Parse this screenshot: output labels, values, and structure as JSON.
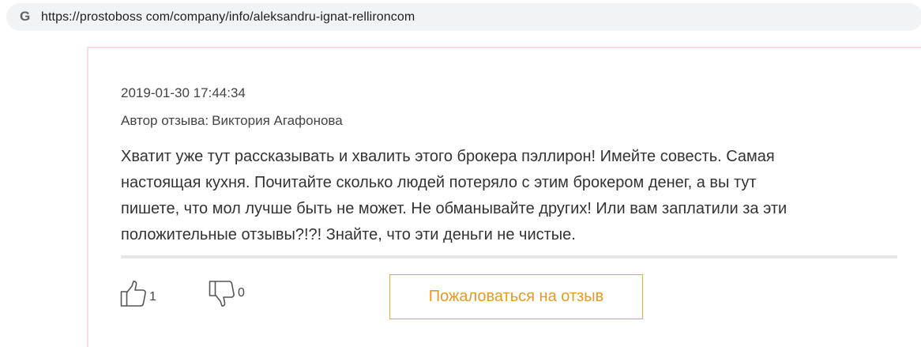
{
  "browser": {
    "url": "https://prostoboss com/company/info/aleksandru-ignat-rellironcom",
    "search_engine_icon": "google-g-icon"
  },
  "review": {
    "date": "2019-01-30 17:44:34",
    "author_label": "Автор отзыва:",
    "author_name": "Виктория Агафонова",
    "text_lines": [
      "Хватит уже тут рассказывать и хвалить этого брокера пэллирон! Имейте совесть. Самая",
      "настоящая кухня. Почитайте сколько людей потеряло с этим брокером денег, а вы тут",
      "пишете, что мол лучше быть не может. Не обманывайте других! Или вам заплатили за эти",
      "положительные отзывы?!?! Знайте, что эти деньги не чистые."
    ],
    "likes": "1",
    "dislikes": "0",
    "report_button_label": "Пожаловаться на отзыв"
  },
  "colors": {
    "accent": "#f0a830",
    "card_border": "#f7dddd",
    "text": "#333333"
  }
}
